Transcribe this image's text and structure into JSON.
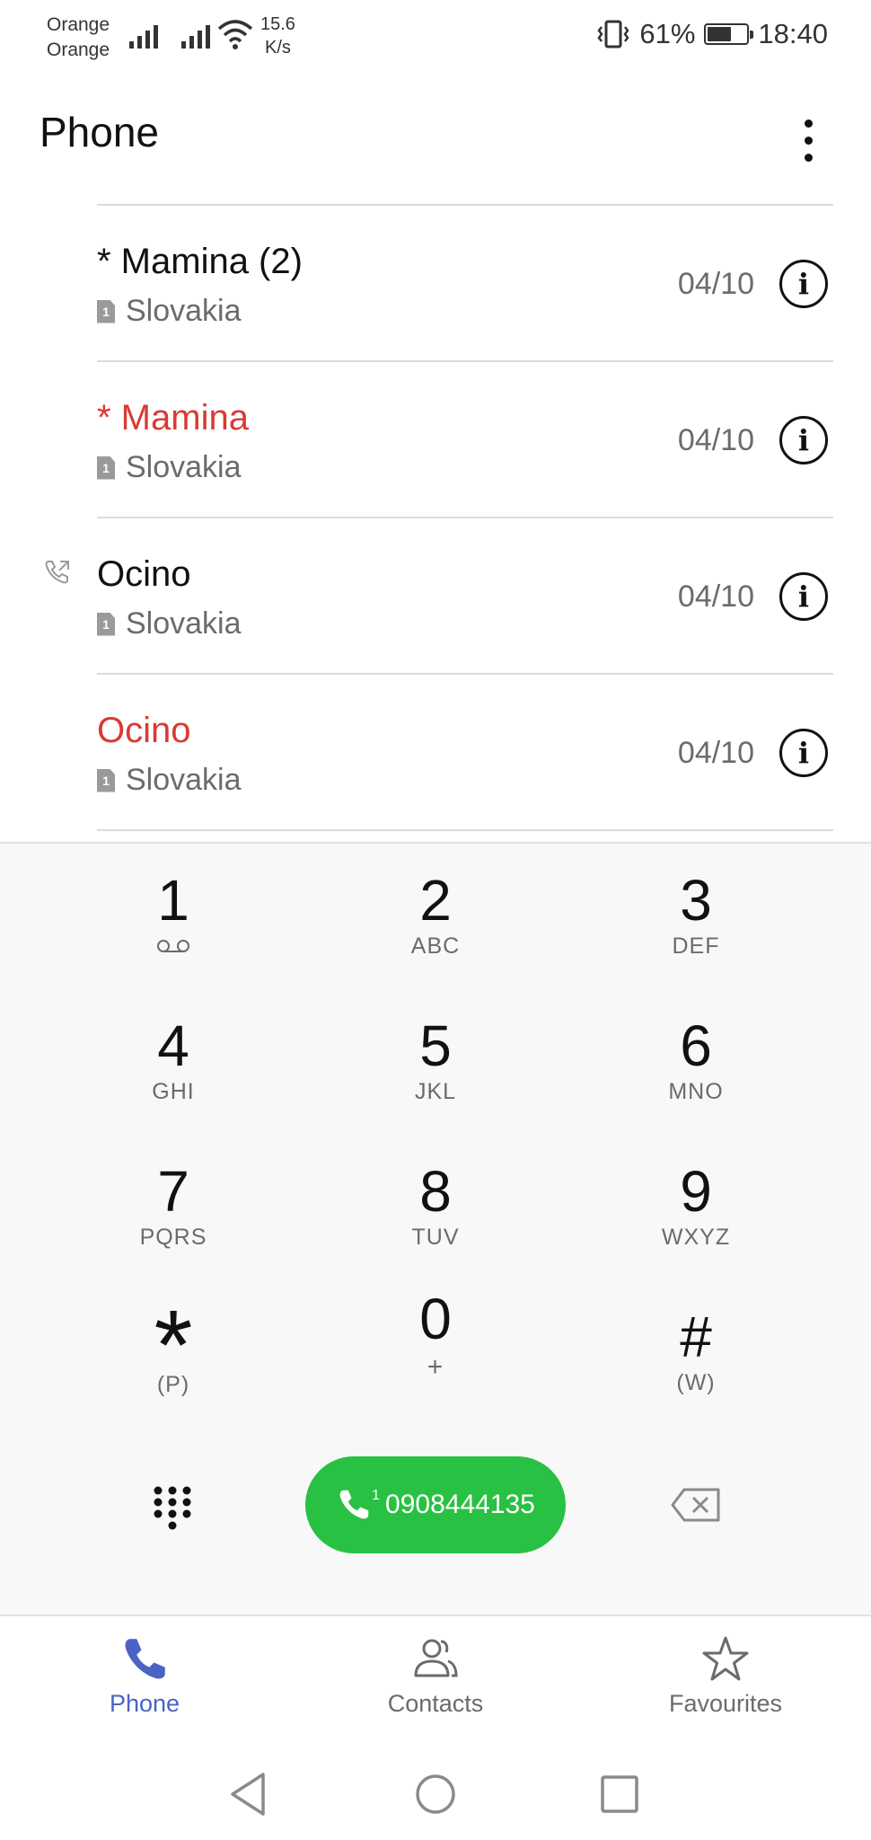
{
  "status_bar": {
    "carrier_1": "Orange",
    "carrier_2": "Orange",
    "speed_value": "15.6",
    "speed_unit": "K/s",
    "battery": "61%",
    "battery_level": 0.61,
    "time": "18:40"
  },
  "header": {
    "title": "Phone"
  },
  "call_log": [
    {
      "name": "* Mamina (2)",
      "missed": false,
      "location": "Slovakia",
      "sim": "1",
      "date": "04/10",
      "outgoing": false
    },
    {
      "name": "* Mamina",
      "missed": true,
      "location": "Slovakia",
      "sim": "1",
      "date": "04/10",
      "outgoing": false
    },
    {
      "name": "Ocino",
      "missed": false,
      "location": "Slovakia",
      "sim": "1",
      "date": "04/10",
      "outgoing": true
    },
    {
      "name": "Ocino",
      "missed": true,
      "location": "Slovakia",
      "sim": "1",
      "date": "04/10",
      "outgoing": false
    }
  ],
  "dialpad": {
    "keys": [
      {
        "digit": "1",
        "letters": ""
      },
      {
        "digit": "2",
        "letters": "ABC"
      },
      {
        "digit": "3",
        "letters": "DEF"
      },
      {
        "digit": "4",
        "letters": "GHI"
      },
      {
        "digit": "5",
        "letters": "JKL"
      },
      {
        "digit": "6",
        "letters": "MNO"
      },
      {
        "digit": "7",
        "letters": "PQRS"
      },
      {
        "digit": "8",
        "letters": "TUV"
      },
      {
        "digit": "9",
        "letters": "WXYZ"
      },
      {
        "digit": "*",
        "letters": "(P)"
      },
      {
        "digit": "0",
        "letters": "+"
      },
      {
        "digit": "#",
        "letters": "(W)"
      }
    ],
    "call_button": {
      "sim": "1",
      "number": "0908444135"
    }
  },
  "bottom_nav": {
    "items": [
      {
        "label": "Phone",
        "active": true
      },
      {
        "label": "Contacts",
        "active": false
      },
      {
        "label": "Favourites",
        "active": false
      }
    ]
  },
  "colors": {
    "missed": "#d93a32",
    "call_button": "#29c143",
    "active_tab": "#4b62c6"
  }
}
